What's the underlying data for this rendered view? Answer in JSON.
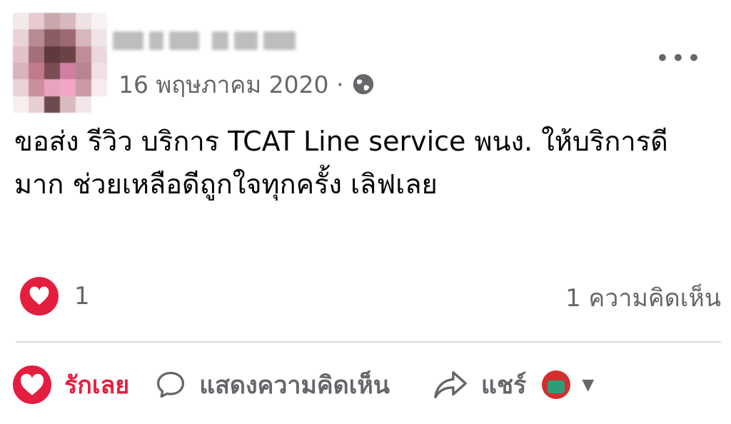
{
  "post": {
    "date": "16 พฤษภาคม 2020 ·",
    "more_label": "•••",
    "text_line1": "ขอส่ง รีวิว บริการ TCAT Line service พนง. ให้บริการดี",
    "text_line2": "มาก ช่วยเหลือดีถูกใจทุกครั้ง เลิฟเลย",
    "reaction_count": "1",
    "comment_count": "1 ความคิดเห็น"
  },
  "actions": {
    "like_label": "รักเลย",
    "comment_label": "แสดงความคิดเห็น",
    "share_label": "แชร์"
  },
  "colors": {
    "love": "#e41e3f",
    "secondary_text": "#65676b",
    "divider": "#d9dbdf"
  },
  "icons": [
    "globe-icon",
    "more-options-icon",
    "heart-icon",
    "comment-icon",
    "share-icon",
    "chevron-down-icon"
  ]
}
